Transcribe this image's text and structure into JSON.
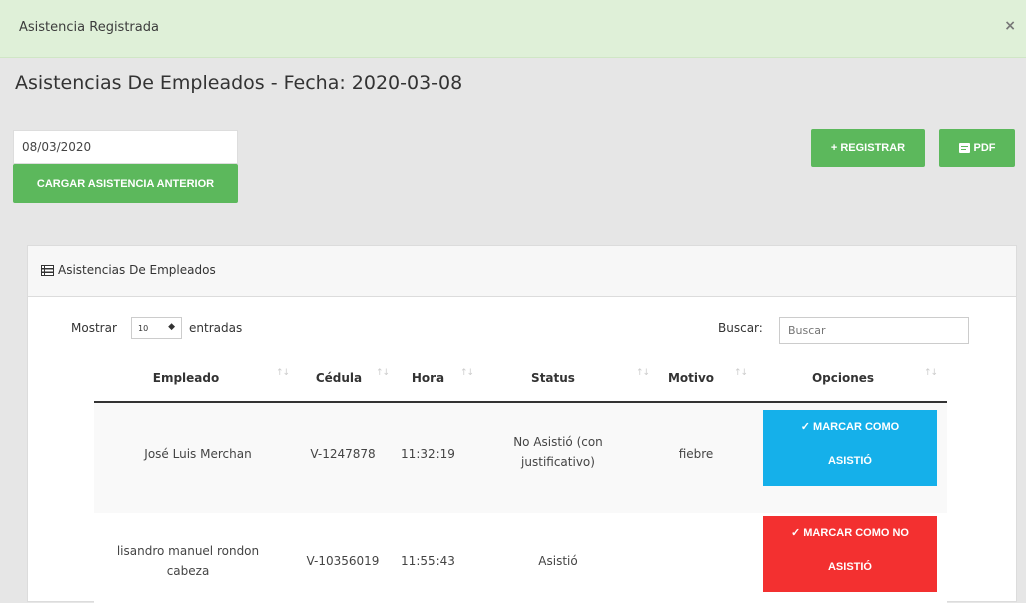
{
  "alert": {
    "text": "Asistencia Registrada",
    "close": "×"
  },
  "page": {
    "title": "Asistencias De Empleados - Fecha: 2020-03-08"
  },
  "controls": {
    "date_value": "08/03/2020",
    "load_label": "CARGAR ASISTENCIA ANTERIOR",
    "register_label": "+ REGISTRAR",
    "pdf_label": "PDF"
  },
  "panel": {
    "title": "Asistencias De Empleados",
    "show_label": "Mostrar",
    "entries_value": "10",
    "entries_label": "entradas",
    "search_label": "Buscar:",
    "search_placeholder": "Buscar"
  },
  "table": {
    "headers": [
      "Empleado",
      "Cédula",
      "Hora",
      "Status",
      "Motivo",
      "Opciones"
    ],
    "rows": [
      {
        "empleado": "José Luis Merchan",
        "cedula": "V-1247878",
        "hora": "11:32:19",
        "status": "No Asistió (con justificativo)",
        "motivo": "fiebre",
        "action": "✓ MARCAR COMO ASISTIÓ"
      },
      {
        "empleado": "lisandro manuel rondon cabeza",
        "cedula": "V-10356019",
        "hora": "11:55:43",
        "status": "Asistió",
        "motivo": "",
        "action": "✓ MARCAR COMO NO ASISTIÓ"
      }
    ]
  },
  "colors": {
    "success": "#5cb85c",
    "alert_bg": "#dff0d8",
    "info": "#15b0ea",
    "danger": "#f33030"
  }
}
